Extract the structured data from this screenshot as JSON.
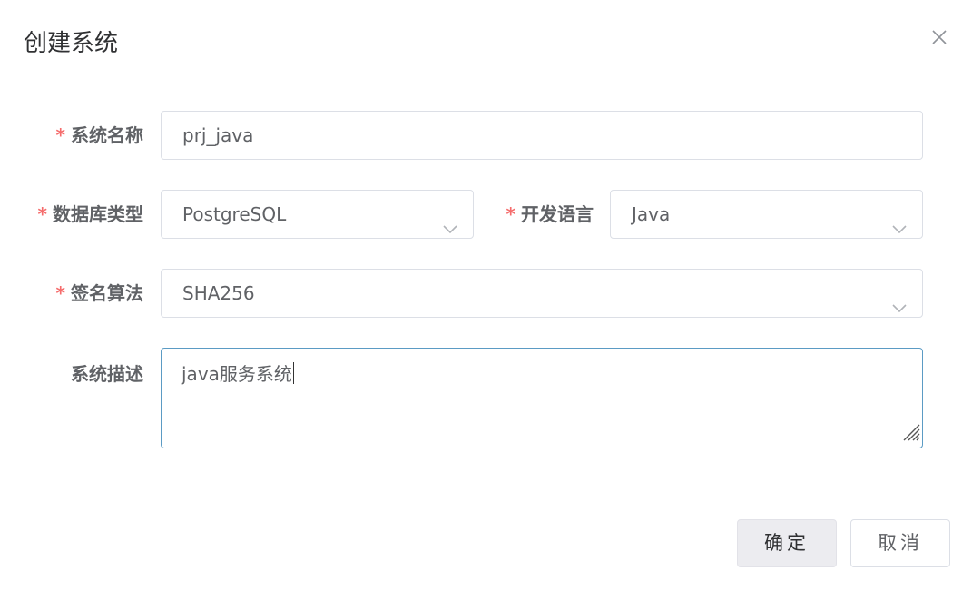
{
  "dialog": {
    "title": "创建系统",
    "close_icon": "close-icon"
  },
  "form": {
    "system_name": {
      "label": "系统名称",
      "required_mark": "*",
      "value": "prj_java"
    },
    "database_type": {
      "label": "数据库类型",
      "required_mark": "*",
      "value": "PostgreSQL",
      "icon": "chevron-down-icon"
    },
    "dev_language": {
      "label": "开发语言",
      "required_mark": "*",
      "value": "Java",
      "icon": "chevron-down-icon"
    },
    "sign_algorithm": {
      "label": "签名算法",
      "required_mark": "*",
      "value": "SHA256",
      "icon": "chevron-down-icon"
    },
    "description": {
      "label": "系统描述",
      "value": "java服务系统",
      "icon": "resize-grip-icon"
    }
  },
  "buttons": {
    "confirm": "确定",
    "cancel": "取消"
  },
  "colors": {
    "required": "#f56c6c",
    "focus_border": "#5b9bc4",
    "border": "#dcdfe6",
    "confirm_bg": "#ececf0"
  }
}
